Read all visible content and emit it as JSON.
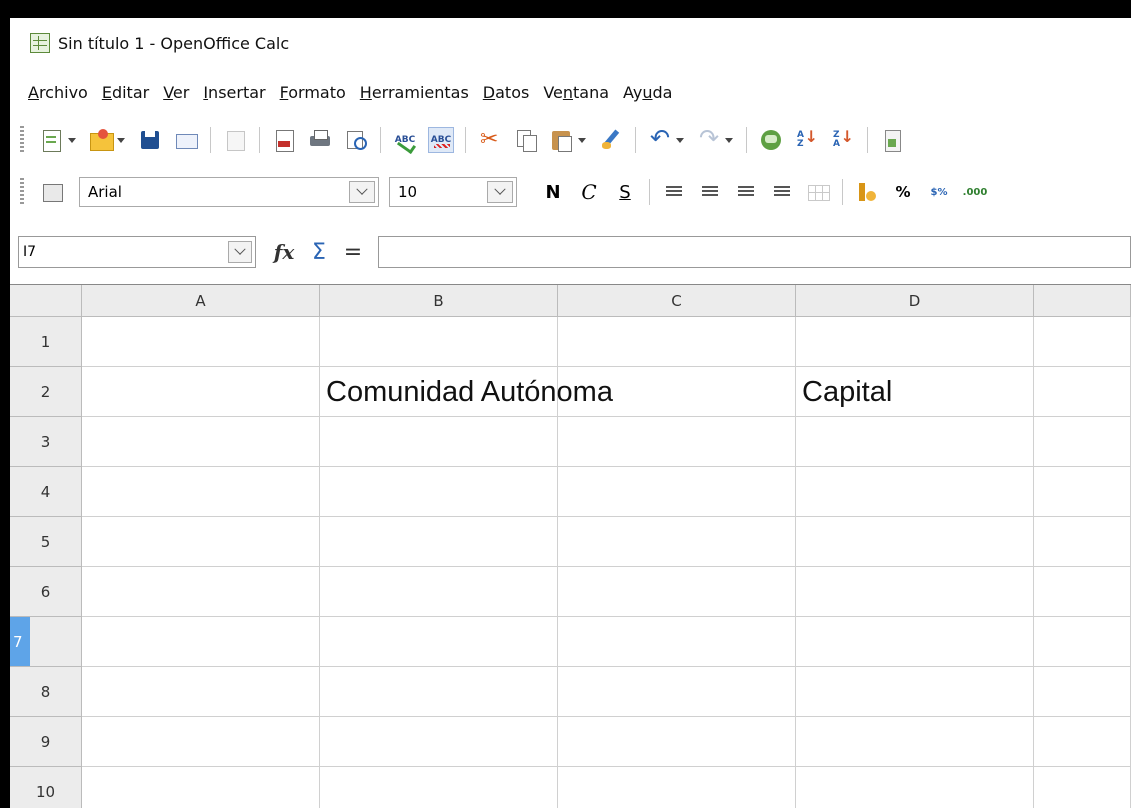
{
  "window": {
    "title": "Sin título 1 - OpenOffice Calc"
  },
  "menu": [
    {
      "label": "Archivo",
      "key": "A",
      "rest": "rchivo"
    },
    {
      "label": "Editar",
      "key": "E",
      "rest": "ditar"
    },
    {
      "label": "Ver",
      "key": "V",
      "rest": "er"
    },
    {
      "label": "Insertar",
      "key": "I",
      "rest": "nsertar"
    },
    {
      "label": "Formato",
      "key": "F",
      "rest": "ormato"
    },
    {
      "label": "Herramientas",
      "key": "H",
      "rest": "erramientas"
    },
    {
      "label": "Datos",
      "key": "D",
      "rest": "atos"
    },
    {
      "label": "Ventana",
      "pre": "Ve",
      "key": "n",
      "rest": "tana"
    },
    {
      "label": "Ayuda",
      "pre": "Ay",
      "key": "u",
      "rest": "da"
    }
  ],
  "toolbar_standard": {
    "spell_label": "ABC",
    "autospell_label": "ABC",
    "sort_asc_top": "A",
    "sort_asc_bottom": "Z",
    "sort_desc_top": "Z",
    "sort_desc_bottom": "A"
  },
  "toolbar_format": {
    "font_name": "Arial",
    "font_size": "10",
    "bold_label": "N",
    "italic_label": "C",
    "underline_label": "S",
    "percent_label": "%",
    "standard_label": "$%",
    "decimal_label": ".000"
  },
  "formula_bar": {
    "cell_ref": "I7",
    "fx_label": "fx",
    "sum_label": "Σ",
    "equals_label": "=",
    "formula_value": ""
  },
  "sheet": {
    "columns": [
      "A",
      "B",
      "C",
      "D"
    ],
    "rows": [
      "1",
      "2",
      "3",
      "4",
      "5",
      "6",
      "7",
      "8",
      "9",
      "10"
    ],
    "active_row": "7",
    "cells": {
      "B2": "Comunidad Autónoma",
      "D2": "Capital"
    }
  },
  "colors": {
    "active_row_header": "#5ea4e8",
    "window_border": "#000000"
  }
}
